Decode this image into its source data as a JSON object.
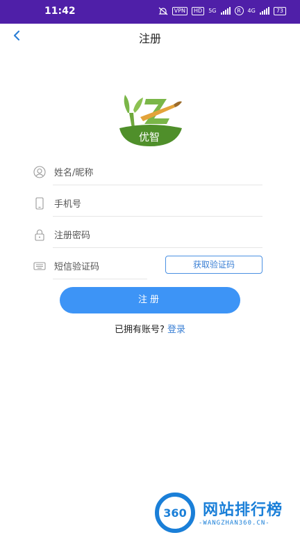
{
  "status_bar": {
    "time": "11:42",
    "vpn": "VPN",
    "hd": "HD",
    "network1": "5G",
    "registered": "R",
    "network2": "4G",
    "battery": "73"
  },
  "nav": {
    "back_icon": "chevron-left-icon",
    "title": "注册"
  },
  "logo": {
    "text": "优智",
    "letters": "YZ"
  },
  "form": {
    "name_placeholder": "姓名/昵称",
    "phone_placeholder": "手机号",
    "password_placeholder": "注册密码",
    "sms_placeholder": "短信验证码",
    "get_code_label": "获取验证码",
    "register_label": "注册"
  },
  "login": {
    "question": "已拥有账号?",
    "link": "登录"
  },
  "watermark": {
    "badge": "360",
    "title": "网站排行榜",
    "subtitle": "-WANGZHAN360.CN-"
  },
  "colors": {
    "status_bar": "#4f1fa8",
    "accent": "#3d94f6",
    "link": "#3a7fd4"
  }
}
